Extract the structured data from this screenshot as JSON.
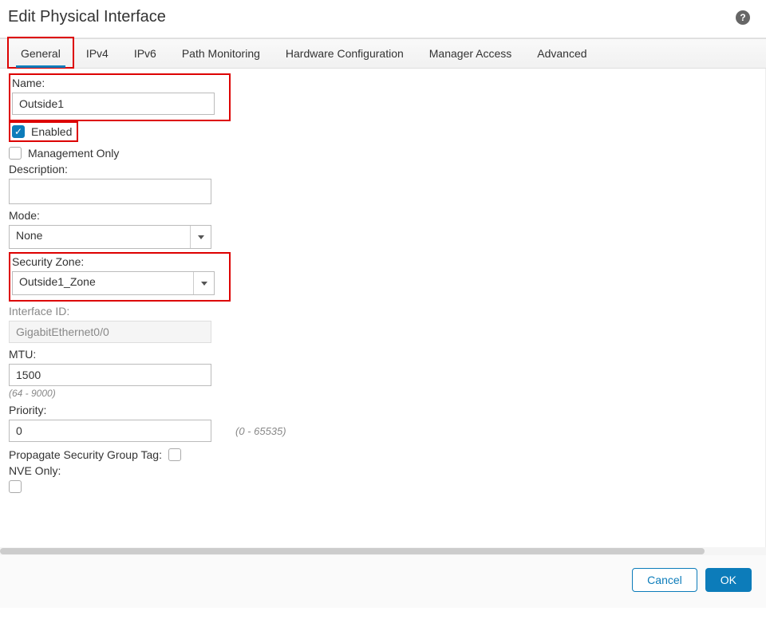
{
  "header": {
    "title": "Edit Physical Interface",
    "help_symbol": "?"
  },
  "tabs": [
    {
      "label": "General",
      "active": true
    },
    {
      "label": "IPv4",
      "active": false
    },
    {
      "label": "IPv6",
      "active": false
    },
    {
      "label": "Path Monitoring",
      "active": false
    },
    {
      "label": "Hardware Configuration",
      "active": false
    },
    {
      "label": "Manager Access",
      "active": false
    },
    {
      "label": "Advanced",
      "active": false
    }
  ],
  "form": {
    "name_label": "Name:",
    "name_value": "Outside1",
    "enabled_label": "Enabled",
    "enabled_checked": true,
    "management_only_label": "Management Only",
    "management_only_checked": false,
    "description_label": "Description:",
    "description_value": "",
    "mode_label": "Mode:",
    "mode_value": "None",
    "zone_label": "Security Zone:",
    "zone_value": "Outside1_Zone",
    "interface_id_label": "Interface ID:",
    "interface_id_value": "GigabitEthernet0/0",
    "mtu_label": "MTU:",
    "mtu_value": "1500",
    "mtu_hint": "(64 - 9000)",
    "priority_label": "Priority:",
    "priority_value": "0",
    "priority_hint": "(0 - 65535)",
    "propagate_label": "Propagate Security Group Tag:",
    "propagate_checked": false,
    "nve_label": "NVE Only:",
    "nve_checked": false
  },
  "footer": {
    "cancel": "Cancel",
    "ok": "OK"
  }
}
